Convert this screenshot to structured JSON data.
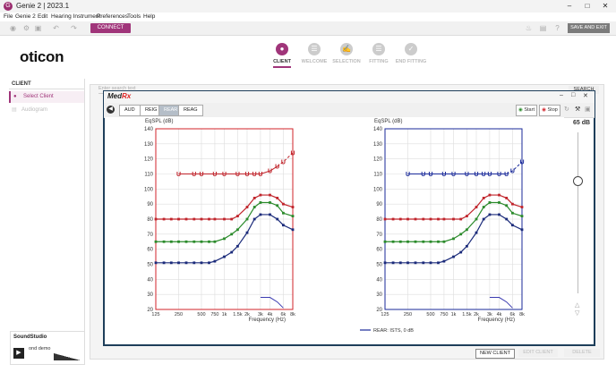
{
  "titlebar": {
    "title": "Genie 2 | 2023.1"
  },
  "menubar": [
    "File",
    "Genie 2",
    "Edit",
    "Hearing Instrument",
    "Preferences",
    "Tools",
    "Help"
  ],
  "toolbar": {
    "connect_label": "CONNECT",
    "save_exit_label": "SAVE AND EXIT"
  },
  "brand": {
    "logo": "oticon"
  },
  "steps": [
    {
      "label": "CLIENT",
      "active": true
    },
    {
      "label": "WELCOME",
      "active": false
    },
    {
      "label": "SELECTION",
      "active": false
    },
    {
      "label": "FITTING",
      "active": false
    },
    {
      "label": "END FITTING",
      "active": false
    }
  ],
  "leftnav": {
    "heading": "CLIENT",
    "items": [
      "Select Client",
      "Audiogram"
    ]
  },
  "search": {
    "placeholder": "Enter search text",
    "button_label": "SEARCH"
  },
  "client_actions": {
    "new": "NEW CLIENT",
    "edit": "EDIT CLIENT",
    "delete": "DELETE"
  },
  "soundstudio": {
    "logo": "SoundStudio",
    "track": "ond demo"
  },
  "medrx": {
    "logo_a": "Med",
    "logo_b": "Rx",
    "tabs": [
      "AUD",
      "REIG",
      "REAR",
      "REAG"
    ],
    "active_tab": "REAR",
    "start_label": "Start",
    "stop_label": "Stop",
    "level": "65 dB",
    "legend_label": "REAR: ISTS, 0 dB"
  },
  "colors": {
    "brand": "#a0357a",
    "medrx_border": "#1e3e5a",
    "red": "#d0232a",
    "blue": "#1a2a9a"
  },
  "chart_data": [
    {
      "type": "line",
      "ear": "right",
      "frame_color": "#d0232a",
      "ylabel": "EqSPL (dB)",
      "xlabel": "Frequency (Hz)",
      "ylim": [
        20,
        140
      ],
      "x_ticks": [
        "125",
        "250",
        "500",
        "750",
        "1k",
        "1.5k",
        "2k",
        "3k",
        "4k",
        "6k",
        "8k"
      ],
      "y_ticks": [
        20,
        30,
        40,
        50,
        60,
        70,
        80,
        90,
        100,
        110,
        120,
        130,
        140
      ],
      "x": [
        125,
        160,
        200,
        250,
        315,
        400,
        500,
        630,
        750,
        1000,
        1250,
        1500,
        2000,
        2500,
        3000,
        4000,
        5000,
        6000,
        8000
      ],
      "series": [
        {
          "color": "#c0232a",
          "marker": "U",
          "values": [
            null,
            null,
            null,
            110,
            null,
            110,
            110,
            null,
            110,
            110,
            null,
            110,
            110,
            110,
            110,
            112,
            115,
            118,
            124
          ]
        },
        {
          "color": "#c0232a",
          "values": [
            80,
            80,
            80,
            80,
            80,
            80,
            80,
            80,
            80,
            80,
            80,
            82,
            88,
            94,
            96,
            96,
            94,
            90,
            88
          ]
        },
        {
          "color": "#2a8a2a",
          "values": [
            65,
            65,
            65,
            65,
            65,
            65,
            65,
            65,
            65,
            67,
            70,
            73,
            80,
            88,
            91,
            91,
            89,
            84,
            82
          ]
        },
        {
          "color": "#1a2a7a",
          "values": [
            51,
            51,
            51,
            51,
            51,
            51,
            51,
            51,
            52,
            55,
            58,
            62,
            71,
            80,
            83,
            83,
            80,
            76,
            73
          ]
        },
        {
          "color": "#3a3ab0",
          "values": [
            null,
            null,
            null,
            null,
            null,
            null,
            null,
            null,
            null,
            null,
            null,
            null,
            null,
            null,
            28,
            28,
            25,
            21,
            null
          ]
        }
      ]
    },
    {
      "type": "line",
      "ear": "left",
      "frame_color": "#1a2a9a",
      "ylabel": "EqSPL (dB)",
      "xlabel": "Frequency (Hz)",
      "ylim": [
        20,
        140
      ],
      "x_ticks": [
        "125",
        "250",
        "500",
        "750",
        "1k",
        "1.5k",
        "2k",
        "3k",
        "4k",
        "6k",
        "8k"
      ],
      "y_ticks": [
        20,
        30,
        40,
        50,
        60,
        70,
        80,
        90,
        100,
        110,
        120,
        130,
        140
      ],
      "x": [
        125,
        160,
        200,
        250,
        315,
        400,
        500,
        630,
        750,
        1000,
        1250,
        1500,
        2000,
        2500,
        3000,
        4000,
        5000,
        6000,
        8000
      ],
      "series": [
        {
          "color": "#1a2a9a",
          "marker": "U",
          "values": [
            null,
            null,
            null,
            110,
            null,
            110,
            110,
            null,
            110,
            110,
            null,
            110,
            110,
            110,
            110,
            110,
            110,
            112,
            118
          ]
        },
        {
          "color": "#c0232a",
          "values": [
            80,
            80,
            80,
            80,
            80,
            80,
            80,
            80,
            80,
            80,
            80,
            82,
            88,
            94,
            96,
            96,
            94,
            90,
            88
          ]
        },
        {
          "color": "#2a8a2a",
          "values": [
            65,
            65,
            65,
            65,
            65,
            65,
            65,
            65,
            65,
            67,
            70,
            73,
            80,
            88,
            91,
            91,
            89,
            84,
            82
          ]
        },
        {
          "color": "#1a2a7a",
          "values": [
            51,
            51,
            51,
            51,
            51,
            51,
            51,
            51,
            52,
            55,
            58,
            62,
            71,
            80,
            83,
            83,
            80,
            76,
            73
          ]
        },
        {
          "color": "#3a3ab0",
          "values": [
            null,
            null,
            null,
            null,
            null,
            null,
            null,
            null,
            null,
            null,
            null,
            null,
            null,
            null,
            28,
            28,
            25,
            21,
            null
          ]
        }
      ]
    }
  ]
}
